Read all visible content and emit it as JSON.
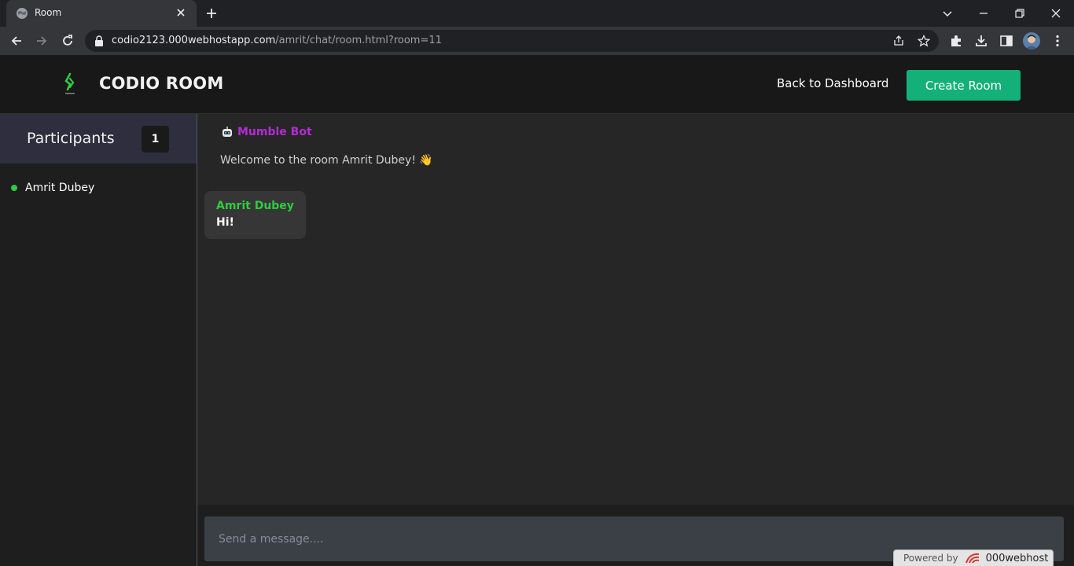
{
  "browser": {
    "tab_title": "Room",
    "url_host": "codio2123.000webhostapp.com",
    "url_path": "/amrit/chat/room.html?room=11"
  },
  "header": {
    "brand": "CODIO ROOM",
    "back_link": "Back to Dashboard",
    "create_button": "Create Room"
  },
  "sidebar": {
    "title": "Participants",
    "count": "1",
    "participants": [
      {
        "name": "Amrit Dubey",
        "status_color": "#2ecc40"
      }
    ]
  },
  "chat": {
    "bot_name": "Mumble Bot",
    "bot_message": "Welcome to the room Amrit Dubey! 👋",
    "messages": [
      {
        "author": "Amrit Dubey",
        "text": "Hi!"
      }
    ],
    "input_placeholder": "Send a message...."
  },
  "footer": {
    "powered_text": "Powered by",
    "powered_brand": "000webhost"
  },
  "colors": {
    "accent": "#14b07a",
    "bot": "#b42bd6",
    "user": "#2ecc40"
  }
}
